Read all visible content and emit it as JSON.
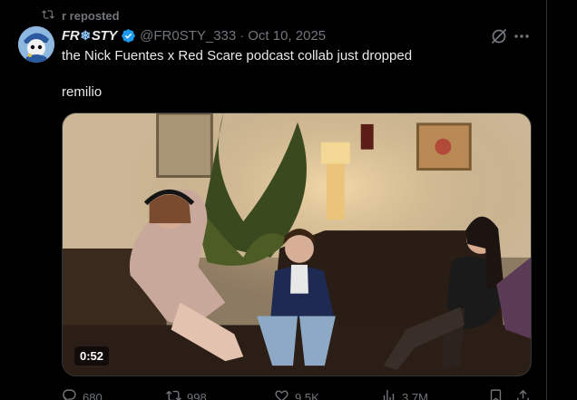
{
  "repost": {
    "label": "r reposted"
  },
  "tweet": {
    "display_name": "FR",
    "display_name_snow": "❄",
    "display_name_tail": "STY",
    "handle": "@FR0STY_333",
    "separator": "·",
    "date": "Oct 10, 2025",
    "text_line1": "the Nick Fuentes x Red Scare podcast collab just dropped",
    "text_line2": "remilio",
    "video_duration": "0:52"
  },
  "actions": {
    "replies": "680",
    "reposts": "998",
    "likes": "9.5K",
    "views": "3.7M"
  },
  "icons": {
    "repost": "repost-icon",
    "verified": "verified-badge-icon",
    "grok": "grok-icon",
    "more": "more-icon",
    "reply": "reply-icon",
    "like": "like-icon",
    "views": "views-icon",
    "bookmark": "bookmark-icon",
    "share": "share-icon"
  },
  "colors": {
    "verified": "#1d9bf0",
    "muted": "#71767b",
    "text": "#e7e9ea"
  }
}
